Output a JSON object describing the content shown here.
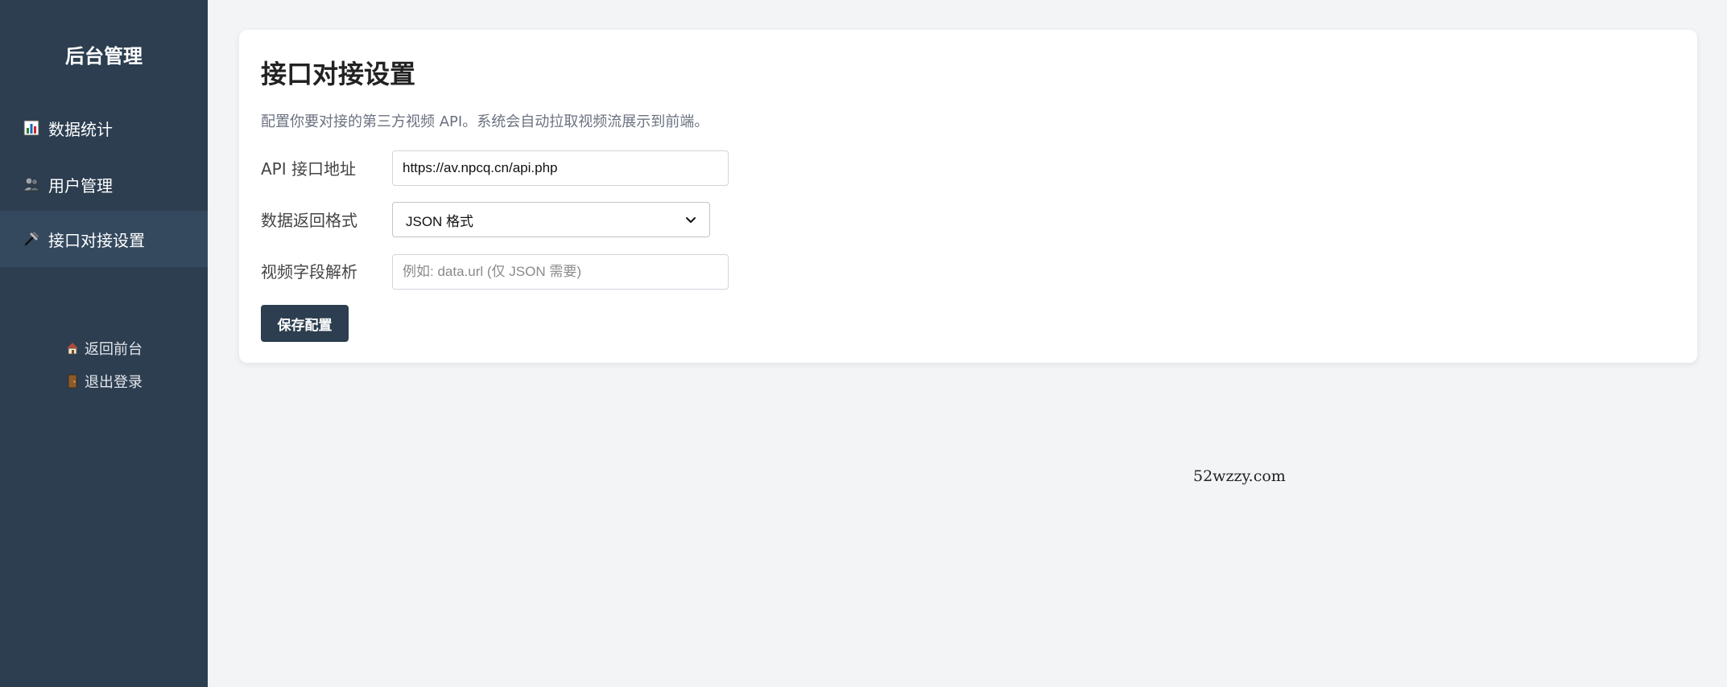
{
  "sidebar": {
    "brand": "后台管理",
    "items": [
      {
        "label": "数据统计",
        "icon": "bar-chart-icon"
      },
      {
        "label": "用户管理",
        "icon": "users-icon"
      },
      {
        "label": "接口对接设置",
        "icon": "link-icon",
        "active": true
      }
    ],
    "bottom_links": [
      {
        "label": "返回前台",
        "icon": "home-icon"
      },
      {
        "label": "退出登录",
        "icon": "door-icon"
      }
    ]
  },
  "main": {
    "title": "接口对接设置",
    "description": "配置你要对接的第三方视频 API。系统会自动拉取视频流展示到前端。",
    "form": {
      "api_url": {
        "label": "API 接口地址",
        "value": "https://av.npcq.cn/api.php"
      },
      "format": {
        "label": "数据返回格式",
        "selected": "JSON 格式"
      },
      "field": {
        "label": "视频字段解析",
        "placeholder": "例如: data.url (仅 JSON 需要)"
      }
    },
    "save_label": "保存配置"
  },
  "watermark": "52wzzy.com",
  "colors": {
    "sidebar_bg": "#2c3e50",
    "sidebar_active": "#34495e",
    "page_bg": "#f3f4f6",
    "button_bg": "#2c3e50"
  }
}
